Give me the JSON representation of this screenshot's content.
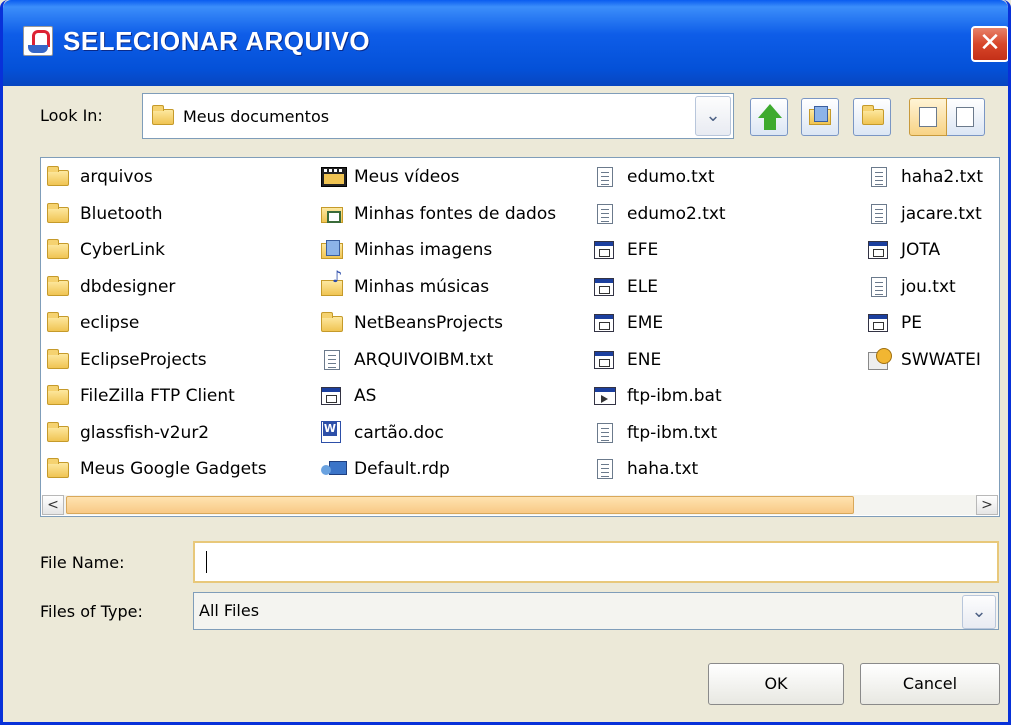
{
  "window": {
    "title": "SELECIONAR ARQUIVO",
    "close_label": "✕"
  },
  "toolbar": {
    "look_in_label": "Look In:",
    "look_in_value": "Meus documentos",
    "buttons": [
      "up-one-level-icon",
      "home-icon",
      "new-folder-icon",
      "list-view-icon",
      "details-view-icon"
    ]
  },
  "files": {
    "columns": [
      [
        {
          "name": "arquivos",
          "icon": "folder"
        },
        {
          "name": "Bluetooth",
          "icon": "folder"
        },
        {
          "name": "CyberLink",
          "icon": "folder"
        },
        {
          "name": "dbdesigner",
          "icon": "folder"
        },
        {
          "name": "eclipse",
          "icon": "folder"
        },
        {
          "name": "EclipseProjects",
          "icon": "folder"
        },
        {
          "name": "FileZilla FTP Client",
          "icon": "folder"
        },
        {
          "name": "glassfish-v2ur2",
          "icon": "folder"
        },
        {
          "name": "Meus Google Gadgets",
          "icon": "folder"
        }
      ],
      [
        {
          "name": "Meus vídeos",
          "icon": "video"
        },
        {
          "name": "Minhas fontes de dados",
          "icon": "data"
        },
        {
          "name": "Minhas imagens",
          "icon": "images"
        },
        {
          "name": "Minhas músicas",
          "icon": "music"
        },
        {
          "name": "NetBeansProjects",
          "icon": "folder"
        },
        {
          "name": "ARQUIVOIBM.txt",
          "icon": "txt"
        },
        {
          "name": "AS",
          "icon": "exe"
        },
        {
          "name": "cartão.doc",
          "icon": "doc"
        },
        {
          "name": "Default.rdp",
          "icon": "rdp"
        }
      ],
      [
        {
          "name": "edumo.txt",
          "icon": "txt"
        },
        {
          "name": "edumo2.txt",
          "icon": "txt"
        },
        {
          "name": "EFE",
          "icon": "exe"
        },
        {
          "name": "ELE",
          "icon": "exe"
        },
        {
          "name": "EME",
          "icon": "exe"
        },
        {
          "name": "ENE",
          "icon": "exe"
        },
        {
          "name": "ftp-ibm.bat",
          "icon": "bat"
        },
        {
          "name": "ftp-ibm.txt",
          "icon": "txt"
        },
        {
          "name": "haha.txt",
          "icon": "txt"
        }
      ],
      [
        {
          "name": "haha2.txt",
          "icon": "txt"
        },
        {
          "name": "jacare.txt",
          "icon": "txt"
        },
        {
          "name": "JOTA",
          "icon": "exe"
        },
        {
          "name": "jou.txt",
          "icon": "txt"
        },
        {
          "name": "PE",
          "icon": "exe"
        },
        {
          "name": "SWWATEI",
          "icon": "sw"
        }
      ]
    ]
  },
  "scrollbar": {
    "left_arrow": "<",
    "right_arrow": ">"
  },
  "form": {
    "file_name_label": "File Name:",
    "file_name_value": "",
    "files_of_type_label": "Files of Type:",
    "files_of_type_value": "All Files"
  },
  "actions": {
    "ok_label": "OK",
    "cancel_label": "Cancel"
  }
}
